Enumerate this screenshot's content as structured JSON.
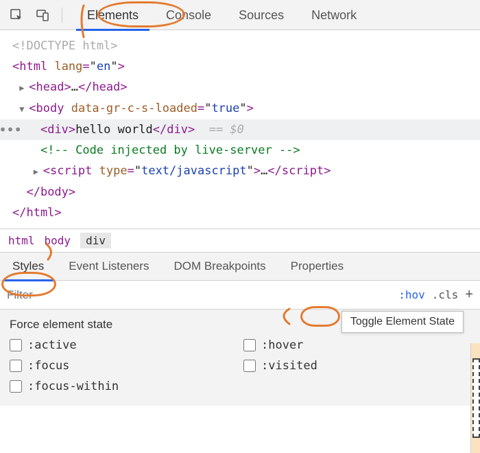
{
  "top_tabs": {
    "elements": "Elements",
    "console": "Console",
    "sources": "Sources",
    "network": "Network"
  },
  "code": {
    "doctype": "<!DOCTYPE html>",
    "html_open_tag": "html",
    "html_attr_name": "lang",
    "html_attr_val": "en",
    "head_tag": "head",
    "ellipsis": "…",
    "body_tag": "body",
    "body_attr_name": "data-gr-c-s-loaded",
    "body_attr_val": "true",
    "div_tag": "div",
    "div_text": "hello world",
    "eq0": "== $0",
    "comment": "<!-- Code injected by live-server -->",
    "script_tag": "script",
    "script_attr_name": "type",
    "script_attr_val": "text/javascript",
    "close_body": "</body>",
    "close_html": "</html>"
  },
  "breadcrumb": {
    "html": "html",
    "body": "body",
    "div": "div"
  },
  "styles_tabs": {
    "styles": "Styles",
    "listeners": "Event Listeners",
    "dom_bp": "DOM Breakpoints",
    "properties": "Properties"
  },
  "filter": {
    "placeholder": "Filter",
    "hov": ":hov",
    "cls": ".cls",
    "plus": "+"
  },
  "tooltip": "Toggle Element State",
  "force_panel": {
    "title": "Force element state",
    "active": ":active",
    "hover": ":hover",
    "focus": ":focus",
    "visited": ":visited",
    "focus_within": ":focus-within"
  }
}
